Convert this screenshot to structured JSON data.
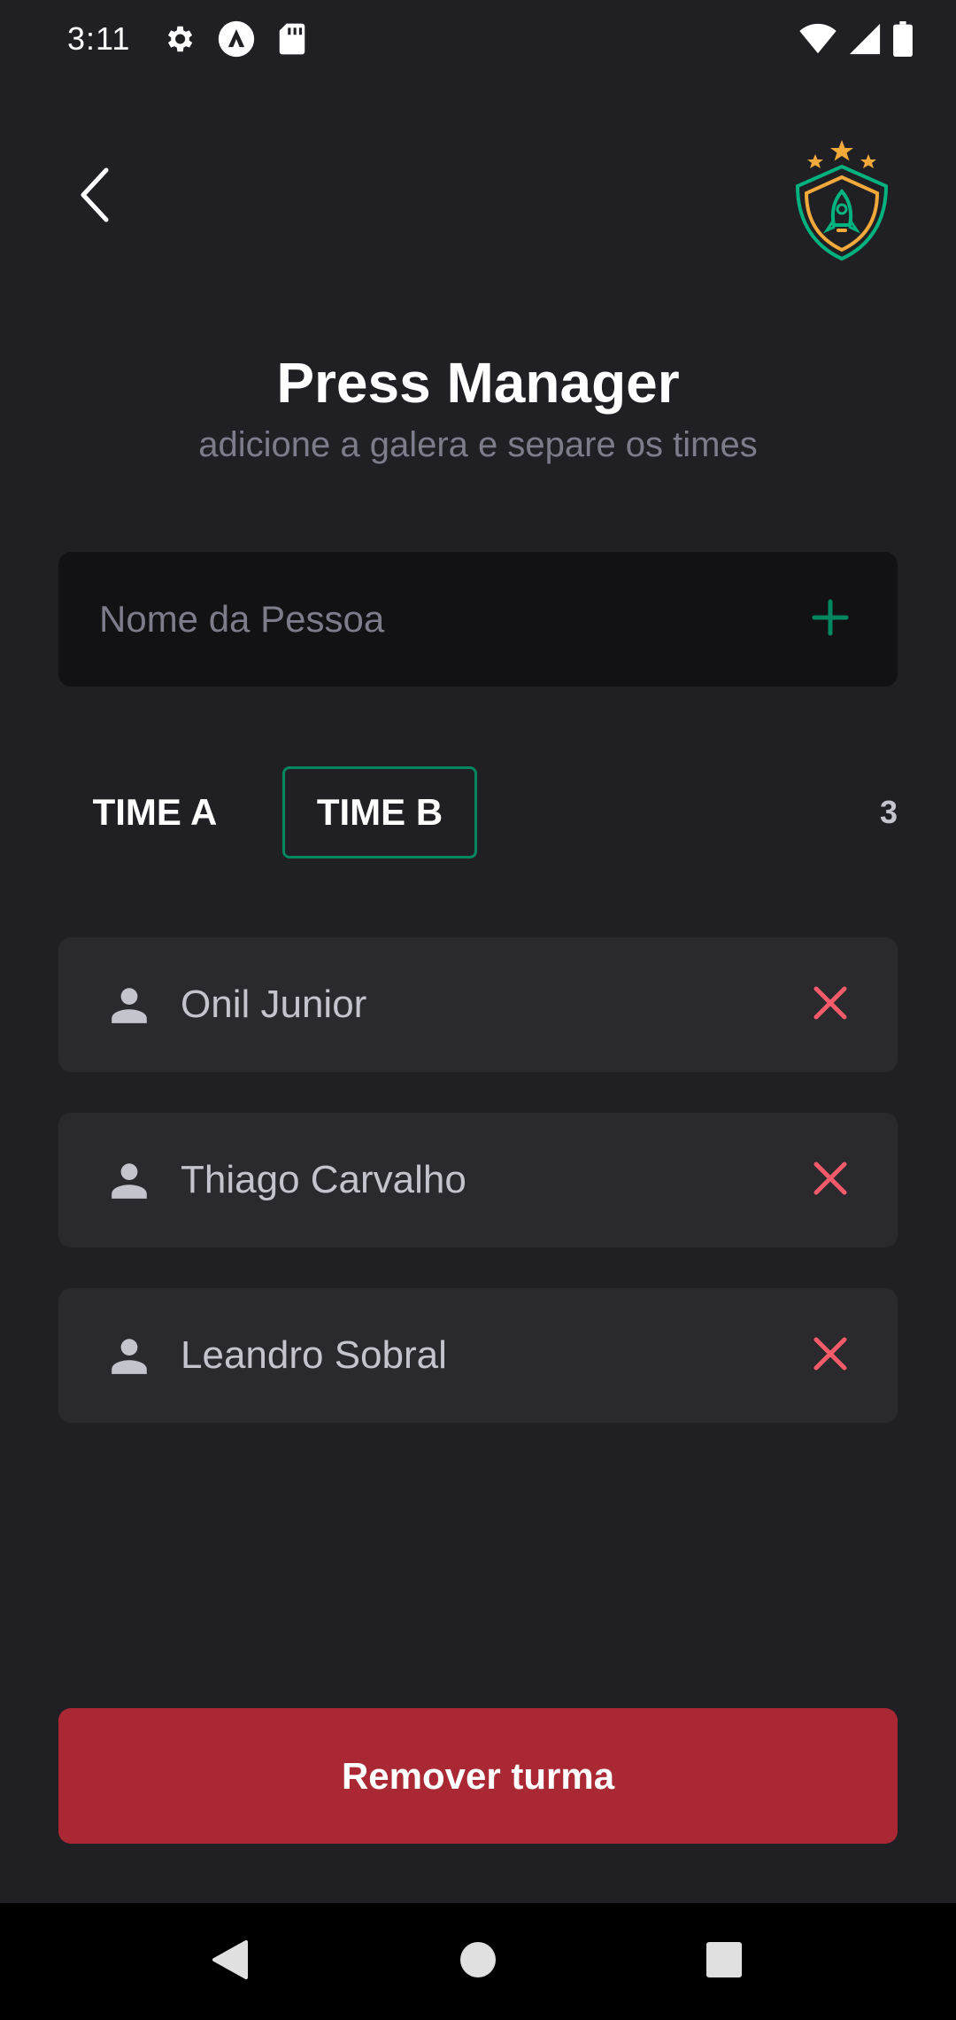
{
  "status_bar": {
    "time": "3:11",
    "icons": [
      "settings-icon",
      "app-notification-icon",
      "sd-card-icon",
      "wifi-icon",
      "signal-icon",
      "battery-icon"
    ]
  },
  "header": {
    "back_icon": "chevron-left-icon",
    "logo": "shield-rocket-stars-logo"
  },
  "page": {
    "title": "Press Manager",
    "subtitle": "adicione a galera e separe os times"
  },
  "input": {
    "placeholder": "Nome da Pessoa",
    "value": "",
    "add_icon": "plus-icon"
  },
  "tabs": {
    "items": [
      {
        "label": "TIME A",
        "selected": false
      },
      {
        "label": "TIME B",
        "selected": true
      }
    ],
    "count": "3"
  },
  "players": [
    {
      "name": "Onil Junior"
    },
    {
      "name": "Thiago Carvalho"
    },
    {
      "name": "Leandro Sobral"
    }
  ],
  "actions": {
    "remove_team_label": "Remover turma"
  },
  "colors": {
    "background": "#202024",
    "input_background": "#121214",
    "card_background": "#29292E",
    "accent_green": "#00875F",
    "danger_red": "#AA2834",
    "remove_icon_red": "#F75A68",
    "star_orange": "#F2A93B"
  },
  "nav_bar": {
    "buttons": [
      "back-triangle-icon",
      "home-circle-icon",
      "recents-square-icon"
    ]
  }
}
